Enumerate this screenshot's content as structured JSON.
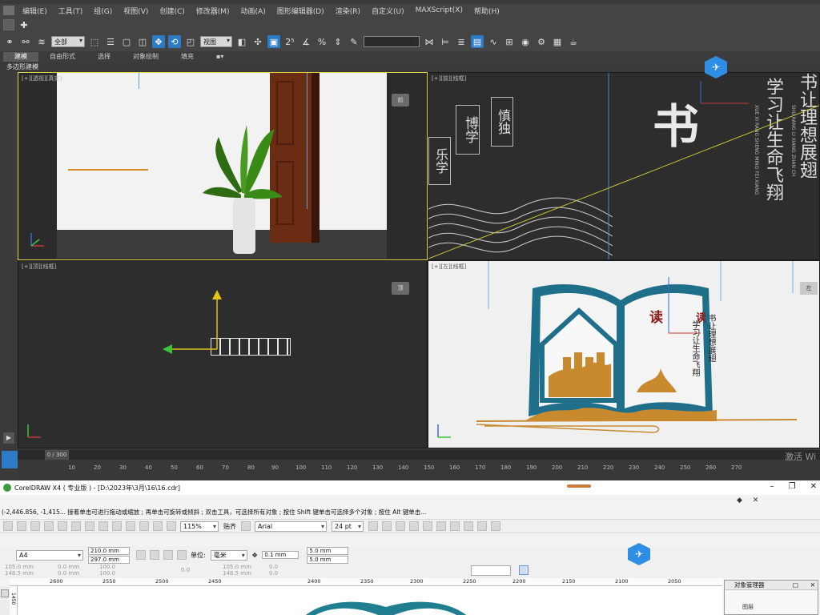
{
  "max": {
    "menus": [
      "编辑(E)",
      "工具(T)",
      "组(G)",
      "视图(V)",
      "创建(C)",
      "修改器(M)",
      "动画(A)",
      "图形编辑器(D)",
      "渲染(R)",
      "自定义(U)",
      "MAXScript(X)",
      "帮助(H)"
    ],
    "selection_filter": "全部",
    "ref_coord": "视图",
    "named_selection": "",
    "ribbon_tabs": [
      "建模",
      "自由形式",
      "选择",
      "对象绘制",
      "填充"
    ],
    "ribbon_active": "建模",
    "subbar_label": "多边形建模",
    "viewports": {
      "perspective": {
        "label": "[+][透视][真实]",
        "cube": "前"
      },
      "front": {
        "label": "[+][前][线框]"
      },
      "top": {
        "label": "[+][顶][线框]",
        "cube": "顶"
      },
      "left": {
        "label": "[+][左][线框]",
        "cube": "左"
      }
    },
    "timeline": {
      "frame": "0 / 300",
      "ticks": [
        "10",
        "20",
        "30",
        "40",
        "50",
        "60",
        "70",
        "80",
        "90",
        "100",
        "110",
        "120",
        "130",
        "140",
        "150",
        "160",
        "170",
        "180",
        "190",
        "200",
        "210",
        "220",
        "230",
        "240",
        "250",
        "260",
        "270"
      ]
    },
    "activate_windows": "激活 Wi",
    "scene_text": {
      "front_calligraphy": "书",
      "front_words_1": "博学",
      "front_words_2": "慎独",
      "front_words_3": "乐学",
      "front_vertical_right": "学习让生命飞翔",
      "front_vertical_right2": "书让理想展翅",
      "front_pinyin_1": "XUE XI RANG SHENG MING FEI XIANG",
      "front_pinyin_2": "SHU RANG LI XIANG ZHAN CH",
      "left_read": "读",
      "left_read2": "读",
      "left_line1": "书让理想展翅",
      "left_line2": "学习让生命飞翔"
    }
  },
  "corel": {
    "title": "CorelDRAW X4 ( 专业版 ) - [D:\\2023年\\3月\\16\\16.cdr]",
    "status": "(-2,446.856, -1,415... 接着单击可进行拖动或缩放 ; 再单击可旋转或倾斜 ; 双击工具，可选择所有对象 ; 按住 Shift 键单击可选择多个对象 ; 按住 Alt 键单击...",
    "zoom": "115%",
    "snap": "贴齐",
    "font": "Arial",
    "font_size": "24 pt",
    "page_size": "A4",
    "width": "210.0 mm",
    "height": "297.0 mm",
    "unit_label": "单位:",
    "unit": "毫米",
    "nudge": "0.1 mm",
    "dup_x": "5.0 mm",
    "dup_y": "5.0 mm",
    "pos_x": "105.0 mm",
    "pos_y": "148.5 mm",
    "size_x": "0.0 mm",
    "size_y": "0.0 mm",
    "scale_x": "100.0",
    "scale_y": "100.0",
    "angle": "0.0",
    "obj_x": "105.0 mm",
    "obj_y": "148.5 mm",
    "obj_w": "0.0",
    "obj_h": "0.0",
    "ruler_ticks": [
      "2600",
      "2550",
      "2500",
      "2450",
      "2400",
      "2350",
      "2300",
      "2250",
      "2200",
      "2150",
      "2100",
      "2050"
    ],
    "vruler_label": "1450",
    "obj_manager_title": "对象管理器",
    "obj_manager_row": "图层"
  },
  "colors": {
    "accent_blue": "#2d7ac6",
    "active_viewport": "#e3d34a",
    "teal_board": "#1f6f8b",
    "orange_board": "#c98a2e",
    "brand_badge": "#2f8de4"
  }
}
